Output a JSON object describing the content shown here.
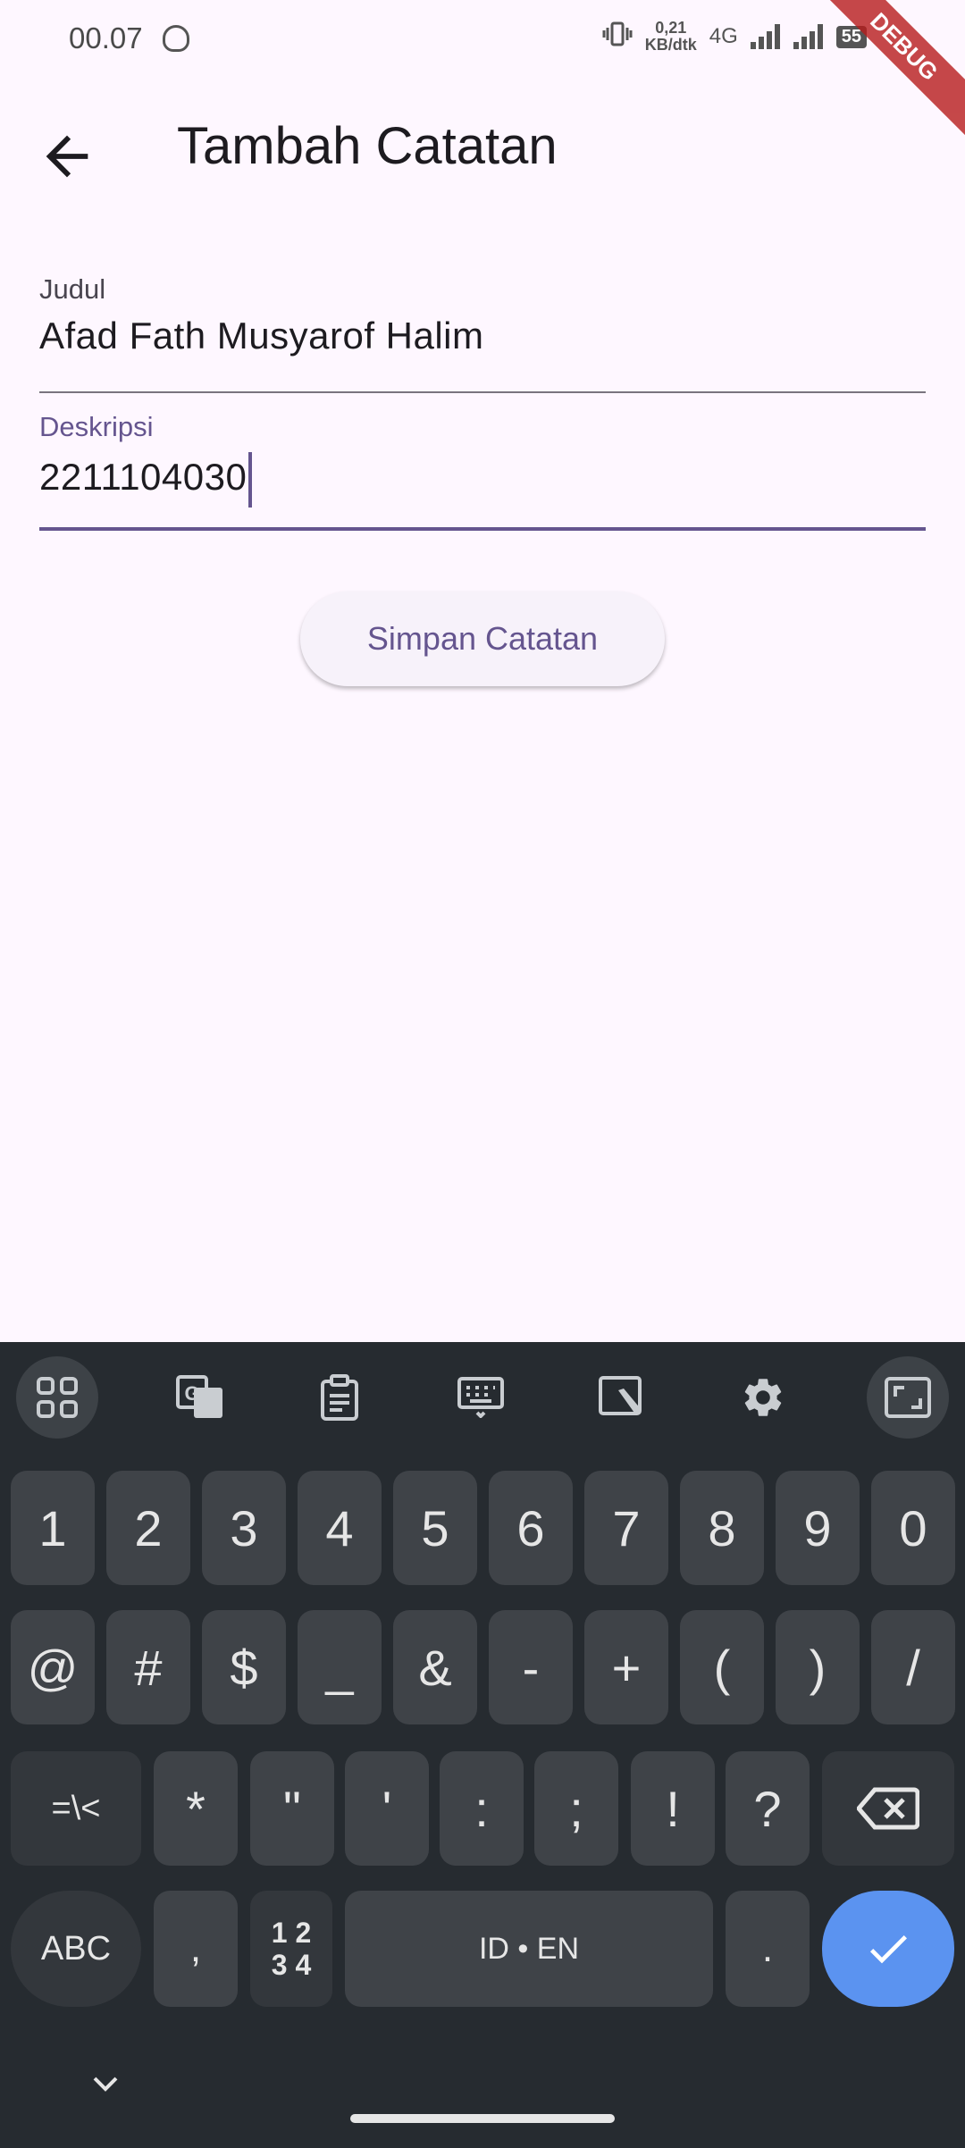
{
  "status_bar": {
    "time": "00.07",
    "speed_top": "0,21",
    "speed_bottom": "KB/dtk",
    "network": "4G",
    "battery": "55"
  },
  "debug_banner": "DEBUG",
  "appbar": {
    "title": "Tambah Catatan"
  },
  "form": {
    "title_label": "Judul",
    "title_value": "Afad Fath Musyarof Halim",
    "desc_label": "Deskripsi",
    "desc_value": "2211104030",
    "save_label": "Simpan Catatan"
  },
  "keyboard": {
    "row1": [
      "1",
      "2",
      "3",
      "4",
      "5",
      "6",
      "7",
      "8",
      "9",
      "0"
    ],
    "row2": [
      "@",
      "#",
      "$",
      "_",
      "&",
      "-",
      "+",
      "(",
      ")",
      "/"
    ],
    "row3": [
      "=\\<",
      "*",
      "\"",
      "'",
      ":",
      ";",
      "!",
      "?"
    ],
    "abc": "ABC",
    "comma": ",",
    "numpad_top": "1 2",
    "numpad_bottom": "3 4",
    "space": "ID • EN",
    "period": ".",
    "accent_color": "#5B93F0"
  }
}
